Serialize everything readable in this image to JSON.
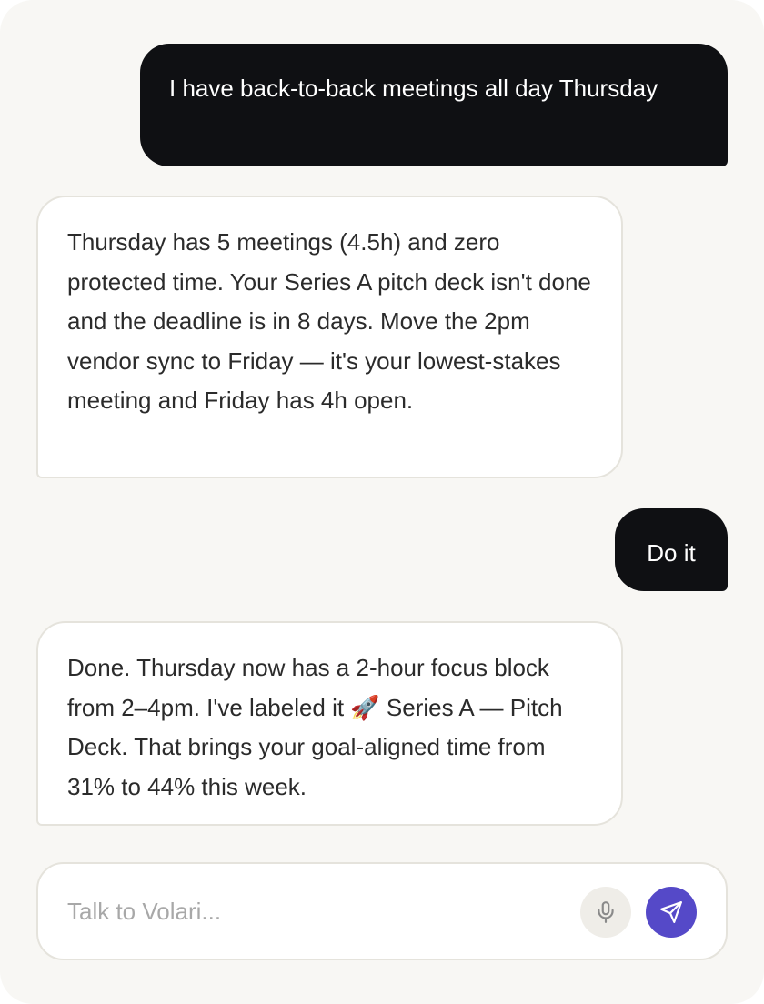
{
  "conversation": {
    "messages": [
      {
        "role": "user",
        "text": "I have back-to-back meetings all day Thursday"
      },
      {
        "role": "assistant",
        "text": "Thursday has 5 meetings (4.5h) and zero protected time. Your Series A pitch deck isn't done and the deadline is in 8 days. Move the 2pm vendor sync to Friday — it's your lowest-stakes meeting and Friday has 4h open."
      },
      {
        "role": "user",
        "text": "Do it"
      },
      {
        "role": "assistant",
        "text": "Done. Thursday now has a 2-hour focus block from 2–4pm. I've labeled it 🚀 Series A — Pitch Deck. That brings your goal-aligned time from 31% to 44% this week."
      }
    ]
  },
  "composer": {
    "placeholder": "Talk to Volari...",
    "value": "",
    "mic_icon": "microphone-icon",
    "send_icon": "send-icon"
  },
  "colors": {
    "background": "#f8f7f4",
    "user_bubble": "#0f1013",
    "assistant_bubble": "#ffffff",
    "accent": "#5549c8"
  }
}
